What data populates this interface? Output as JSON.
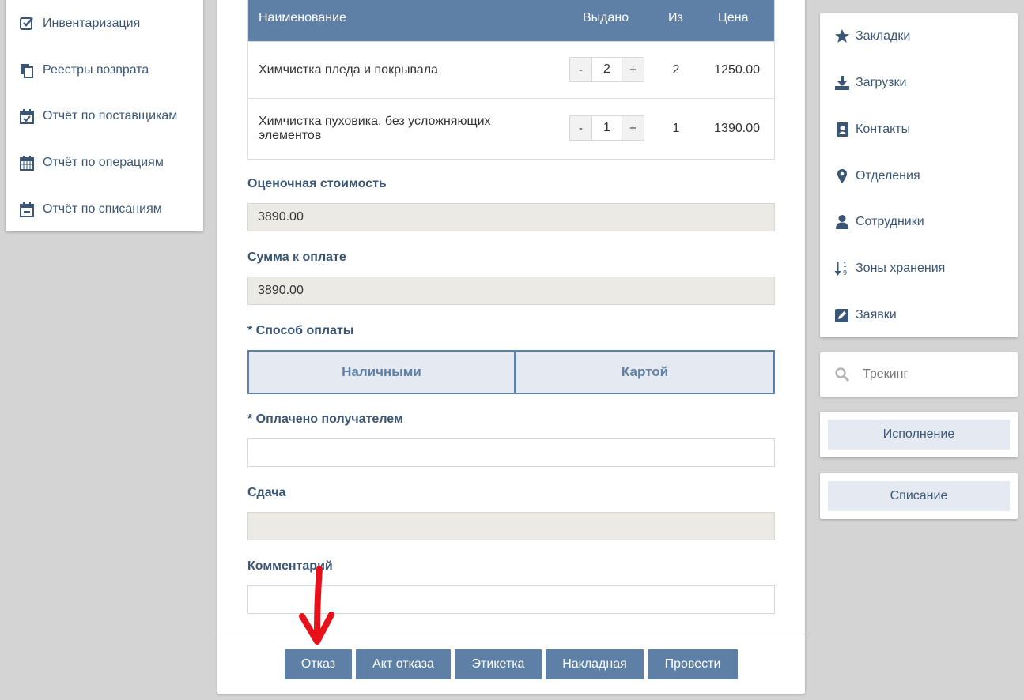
{
  "left_menu": {
    "items": [
      {
        "label": "Инвентаризация",
        "icon": "check-square-icon"
      },
      {
        "label": "Реестры возврата",
        "icon": "copy-icon"
      },
      {
        "label": "Отчёт по поставщикам",
        "icon": "calendar-check-icon"
      },
      {
        "label": "Отчёт по операциям",
        "icon": "calendar-grid-icon"
      },
      {
        "label": "Отчёт по списаниям",
        "icon": "calendar-minus-icon"
      }
    ]
  },
  "table": {
    "headers": {
      "name": "Наименование",
      "issued": "Выдано",
      "of": "Из",
      "price": "Цена"
    },
    "rows": [
      {
        "name": "Химчистка пледа и покрывала",
        "issued": "2",
        "of": "2",
        "price": "1250.00"
      },
      {
        "name": "Химчистка пуховика, без усложняющих элементов",
        "issued": "1",
        "of": "1",
        "price": "1390.00"
      }
    ],
    "minus": "-",
    "plus": "+"
  },
  "form": {
    "estimate_label": "Оценочная стоимость",
    "estimate_value": "3890.00",
    "sum_label": "Сумма к оплате",
    "sum_value": "3890.00",
    "payment_label": "* Способ оплаты",
    "payment_cash": "Наличными",
    "payment_card": "Картой",
    "paid_label": "* Оплачено получателем",
    "paid_value": "",
    "change_label": "Сдача",
    "change_value": "",
    "comment_label": "Комментарий",
    "comment_value": ""
  },
  "actions": {
    "refuse": "Отказ",
    "refuse_act": "Акт отказа",
    "label": "Этикетка",
    "invoice": "Накладная",
    "post": "Провести"
  },
  "right_menu": {
    "items": [
      {
        "label": "Закладки",
        "icon": "star-icon"
      },
      {
        "label": "Загрузки",
        "icon": "download-icon"
      },
      {
        "label": "Контакты",
        "icon": "address-book-icon"
      },
      {
        "label": "Отделения",
        "icon": "map-marker-icon"
      },
      {
        "label": "Сотрудники",
        "icon": "user-icon"
      },
      {
        "label": "Зоны хранения",
        "icon": "sort-numeric-icon"
      },
      {
        "label": "Заявки",
        "icon": "edit-icon"
      }
    ]
  },
  "tracking": {
    "placeholder": "Трекинг"
  },
  "side_buttons": {
    "execution": "Исполнение",
    "writeoff": "Списание"
  },
  "colors": {
    "primary": "#5e80a6",
    "text": "#3a5674",
    "annotation": "#e8111b"
  }
}
